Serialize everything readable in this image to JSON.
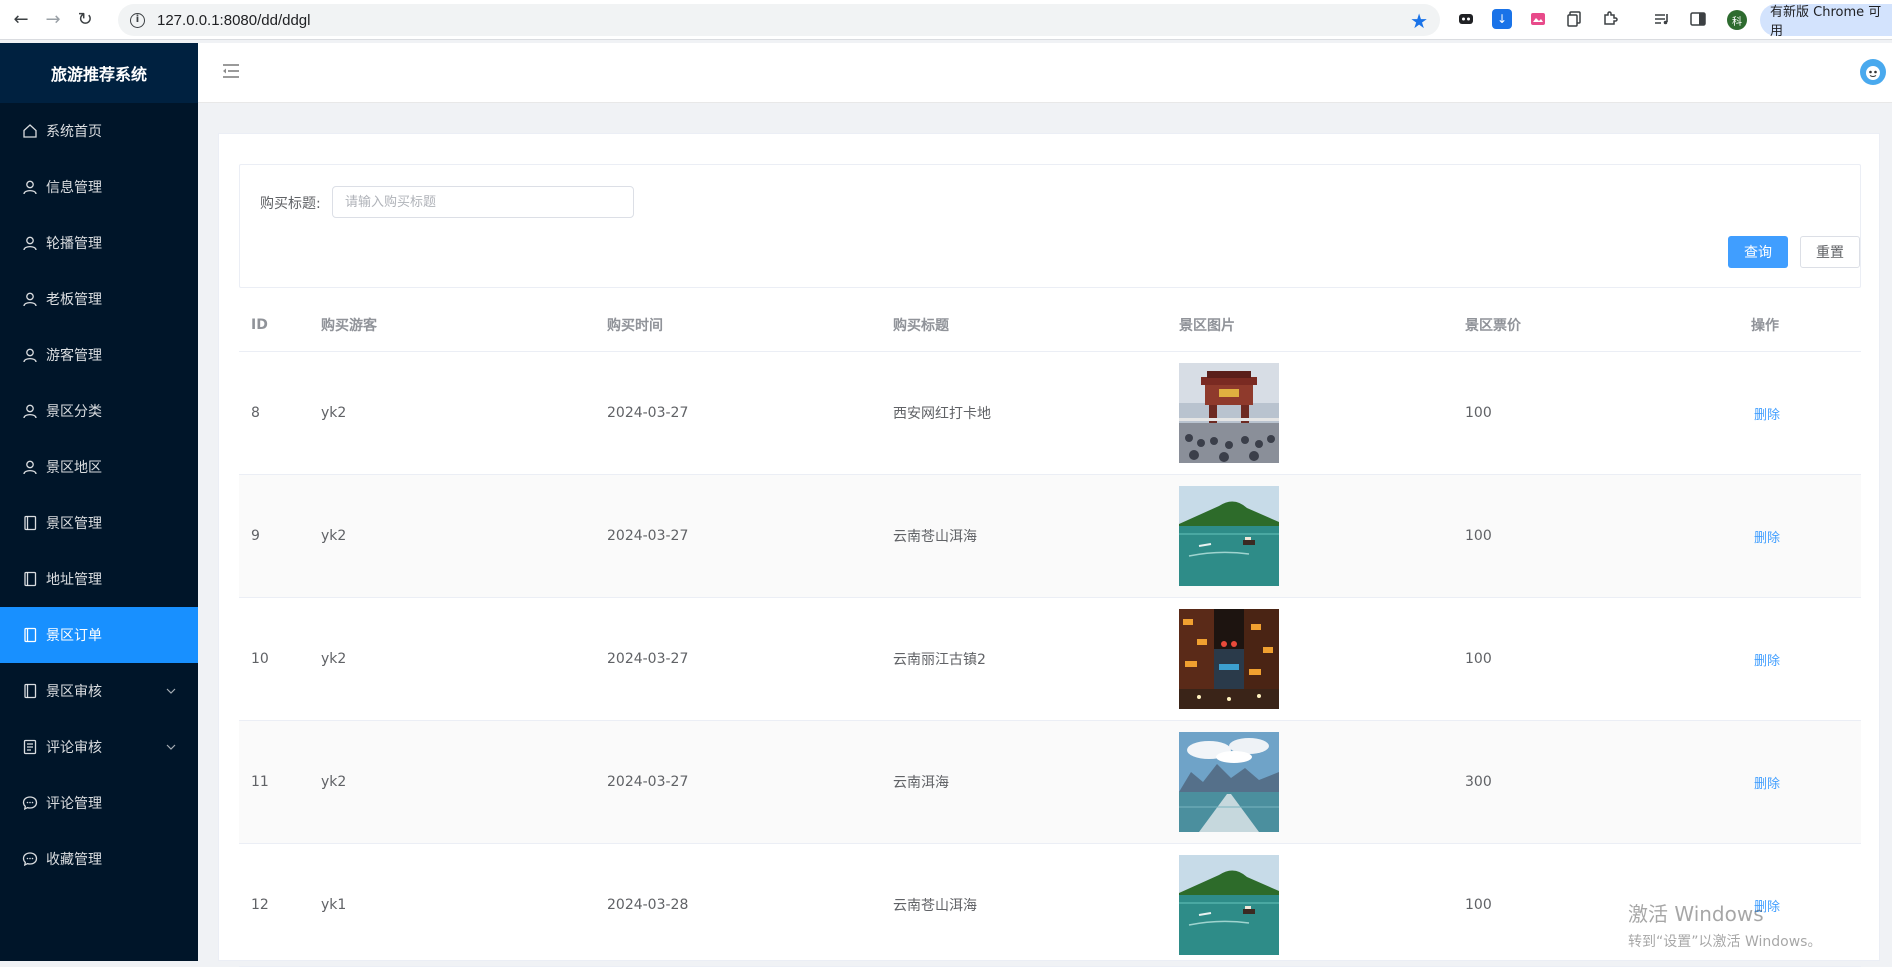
{
  "browser": {
    "url": "127.0.0.1:8080/dd/ddgl",
    "update_label": "有新版 Chrome 可用",
    "profile_initial": "科"
  },
  "sidebar": {
    "title": "旅游推荐系统",
    "items": [
      {
        "label": "系统首页",
        "icon": "home-icon"
      },
      {
        "label": "信息管理",
        "icon": "user-icon"
      },
      {
        "label": "轮播管理",
        "icon": "user-icon"
      },
      {
        "label": "老板管理",
        "icon": "user-icon"
      },
      {
        "label": "游客管理",
        "icon": "user-icon"
      },
      {
        "label": "景区分类",
        "icon": "user-icon"
      },
      {
        "label": "景区地区",
        "icon": "user-icon"
      },
      {
        "label": "景区管理",
        "icon": "notebook-icon"
      },
      {
        "label": "地址管理",
        "icon": "notebook-icon"
      },
      {
        "label": "景区订单",
        "icon": "notebook-icon",
        "active": true
      },
      {
        "label": "景区审核",
        "icon": "notebook-icon",
        "submenu": true
      },
      {
        "label": "评论审核",
        "icon": "document-icon",
        "submenu": true
      },
      {
        "label": "评论管理",
        "icon": "chat-icon"
      },
      {
        "label": "收藏管理",
        "icon": "chat-icon"
      }
    ]
  },
  "search": {
    "label": "购买标题:",
    "placeholder": "请输入购买标题",
    "query_button": "查询",
    "reset_button": "重置"
  },
  "table": {
    "columns": [
      "ID",
      "购买游客",
      "购买时间",
      "购买标题",
      "景区图片",
      "景区票价",
      "操作"
    ],
    "rows": [
      {
        "id": "8",
        "user": "yk2",
        "time": "2024-03-27",
        "title": "西安网红打卡地",
        "image": "xian-gate-photo",
        "price": "100",
        "action": "删除"
      },
      {
        "id": "9",
        "user": "yk2",
        "time": "2024-03-27",
        "title": "云南苍山洱海",
        "image": "lake-boat-photo",
        "price": "100",
        "action": "删除"
      },
      {
        "id": "10",
        "user": "yk2",
        "time": "2024-03-27",
        "title": "云南丽江古镇2",
        "image": "lijiang-night-photo",
        "price": "100",
        "action": "删除"
      },
      {
        "id": "11",
        "user": "yk2",
        "time": "2024-03-27",
        "title": "云南洱海",
        "image": "erhai-lake-photo",
        "price": "300",
        "action": "删除"
      },
      {
        "id": "12",
        "user": "yk1",
        "time": "2024-03-28",
        "title": "云南苍山洱海",
        "image": "lake-boat-photo",
        "price": "100",
        "action": "删除"
      }
    ]
  },
  "watermark": {
    "line1": "激活 Windows",
    "line2": "转到“设置”以激活 Windows。"
  },
  "colors": {
    "sidebar_bg": "#001529",
    "active": "#1890ff",
    "primary": "#409eff"
  }
}
